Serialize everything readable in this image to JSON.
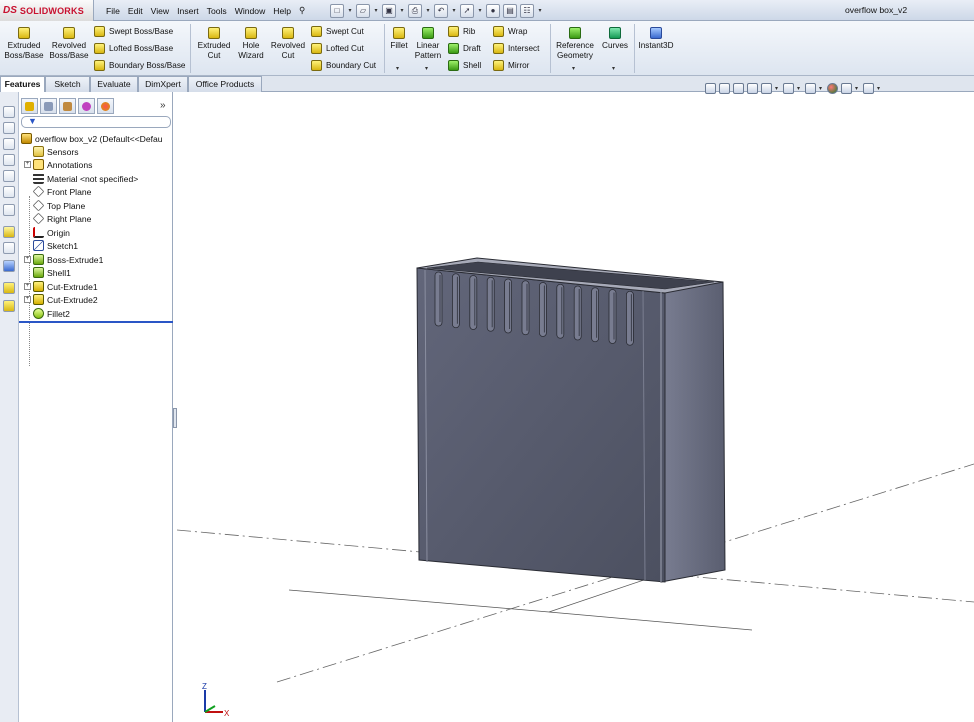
{
  "app": {
    "logo_ds": "DS",
    "logo_name": "SOLIDWORKS",
    "document_title": "overflow box_v2"
  },
  "menus": [
    "File",
    "Edit",
    "View",
    "Insert",
    "Tools",
    "Window",
    "Help"
  ],
  "quick_access": [
    "new-icon",
    "open-icon",
    "save-icon",
    "print-icon",
    "undo-icon",
    "select-icon",
    "rebuild-icon",
    "file-properties-icon",
    "options-icon"
  ],
  "ribbon": {
    "extruded_boss": "Extruded Boss/Base",
    "revolved_boss": "Revolved Boss/Base",
    "swept_boss": "Swept Boss/Base",
    "lofted_boss": "Lofted Boss/Base",
    "boundary_boss": "Boundary Boss/Base",
    "extruded_cut": "Extruded Cut",
    "hole_wizard": "Hole Wizard",
    "revolved_cut": "Revolved Cut",
    "swept_cut": "Swept Cut",
    "lofted_cut": "Lofted Cut",
    "boundary_cut": "Boundary Cut",
    "fillet": "Fillet",
    "linear_pattern": "Linear Pattern",
    "rib": "Rib",
    "draft": "Draft",
    "shell": "Shell",
    "wrap": "Wrap",
    "intersect": "Intersect",
    "mirror": "Mirror",
    "reference_geometry": "Reference Geometry",
    "curves": "Curves",
    "instant3d": "Instant3D"
  },
  "tabs": [
    "Features",
    "Sketch",
    "Evaluate",
    "DimXpert",
    "Office Products"
  ],
  "active_tab": "Features",
  "feature_tree": {
    "root": "overflow box_v2  (Default<<Defau",
    "items": [
      {
        "label": "Sensors",
        "expandable": false,
        "icon": "sensor-icon"
      },
      {
        "label": "Annotations",
        "expandable": true,
        "icon": "annotations-icon"
      },
      {
        "label": "Material <not specified>",
        "expandable": false,
        "icon": "material-icon"
      },
      {
        "label": "Front Plane",
        "expandable": false,
        "icon": "plane-icon"
      },
      {
        "label": "Top Plane",
        "expandable": false,
        "icon": "plane-icon"
      },
      {
        "label": "Right Plane",
        "expandable": false,
        "icon": "plane-icon"
      },
      {
        "label": "Origin",
        "expandable": false,
        "icon": "origin-icon"
      },
      {
        "label": "Sketch1",
        "expandable": false,
        "icon": "sketch-icon"
      },
      {
        "label": "Boss-Extrude1",
        "expandable": true,
        "icon": "extrude-icon"
      },
      {
        "label": "Shell1",
        "expandable": false,
        "icon": "shell-icon"
      },
      {
        "label": "Cut-Extrude1",
        "expandable": true,
        "icon": "cut-extrude-icon"
      },
      {
        "label": "Cut-Extrude2",
        "expandable": true,
        "icon": "cut-extrude-icon"
      },
      {
        "label": "Fillet2",
        "expandable": false,
        "icon": "fillet-icon"
      }
    ]
  },
  "viewport": {
    "triad_x": "X",
    "triad_z": "Z",
    "part_color": "#5a5e6c"
  }
}
